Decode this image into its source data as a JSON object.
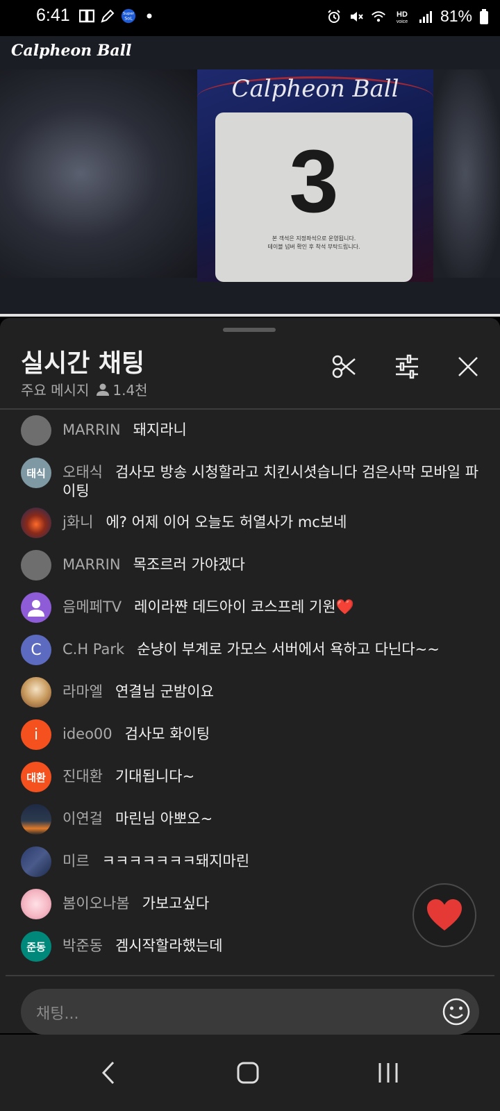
{
  "status_bar": {
    "time": "6:41",
    "battery": "81%",
    "left_icons": [
      "cast-icon",
      "pencil-icon",
      "super-sol-icon",
      "dot-icon"
    ],
    "right_icons": [
      "alarm-icon",
      "mute-icon",
      "wifi-icon",
      "hd-voice-icon",
      "signal-icon",
      "battery-icon"
    ],
    "super_sol_line1": "Super",
    "super_sol_line2": "SoL",
    "hd_label": "HD",
    "voice_label": "voice"
  },
  "video": {
    "channel_logo": "Calpheon Ball",
    "poster_title": "Calpheon Ball",
    "poster_number": "3",
    "poster_fine_line1": "본 객석은 지정좌석으로 운영됩니다.",
    "poster_fine_line2": "테이블 넘버 확인 후 착석 부탁드립니다."
  },
  "chat": {
    "title": "실시간 채팅",
    "subtitle": "주요 메시지",
    "viewer_count": "1.4천",
    "input_placeholder": "채팅...",
    "messages": [
      {
        "author": "MARRIN",
        "text": "돼지라니",
        "avatar_text": "",
        "avatar_color": "#6e6e6e"
      },
      {
        "author": "오태식",
        "text": "검사모 방송 시청할라고 치킨시셧습니다 검은사막 모바일 파이팅",
        "avatar_text": "태식",
        "avatar_color": "#7e98a4"
      },
      {
        "author": "j화니",
        "text": "에? 어제 이어 오늘도 허열사가 mc보네",
        "avatar_text": "",
        "avatar_color": "#8a2a1a"
      },
      {
        "author": "MARRIN",
        "text": "목조르러 가야겠다",
        "avatar_text": "",
        "avatar_color": "#6e6e6e"
      },
      {
        "author": "음메페TV",
        "text": "레이라쨘 데드아이 코스프레 기원❤️",
        "avatar_text": "",
        "avatar_color": "#8d5cd6"
      },
      {
        "author": "C.H Park",
        "text": "순냥이 부계로 가모스 서버에서 욕하고 다닌다~~",
        "avatar_text": "C",
        "avatar_color": "#5c6bc0"
      },
      {
        "author": "라마엘",
        "text": "연결님 군밤이요",
        "avatar_text": "",
        "avatar_color": "#c89a5e"
      },
      {
        "author": "ideo00",
        "text": "검사모 화이팅",
        "avatar_text": "i",
        "avatar_color": "#f4511e"
      },
      {
        "author": "진대환",
        "text": "기대됩니다~",
        "avatar_text": "대환",
        "avatar_color": "#f4511e"
      },
      {
        "author": "이연걸",
        "text": "마린님 아뽀오~",
        "avatar_text": "",
        "avatar_color": "#2c3a4e"
      },
      {
        "author": "미르",
        "text": "ㅋㅋㅋㅋㅋㅋㅋ돼지마린",
        "avatar_text": "",
        "avatar_color": "#3b4a7a"
      },
      {
        "author": "봄이오나봄",
        "text": "가보고싶다",
        "avatar_text": "",
        "avatar_color": "#f5b8c4"
      },
      {
        "author": "박준동",
        "text": "겜시작할라했는데",
        "avatar_text": "준동",
        "avatar_color": "#00897b"
      }
    ]
  },
  "colors": {
    "panel_bg": "#212121",
    "author_gray": "#aaaaaa",
    "heart_red": "#e53935"
  }
}
